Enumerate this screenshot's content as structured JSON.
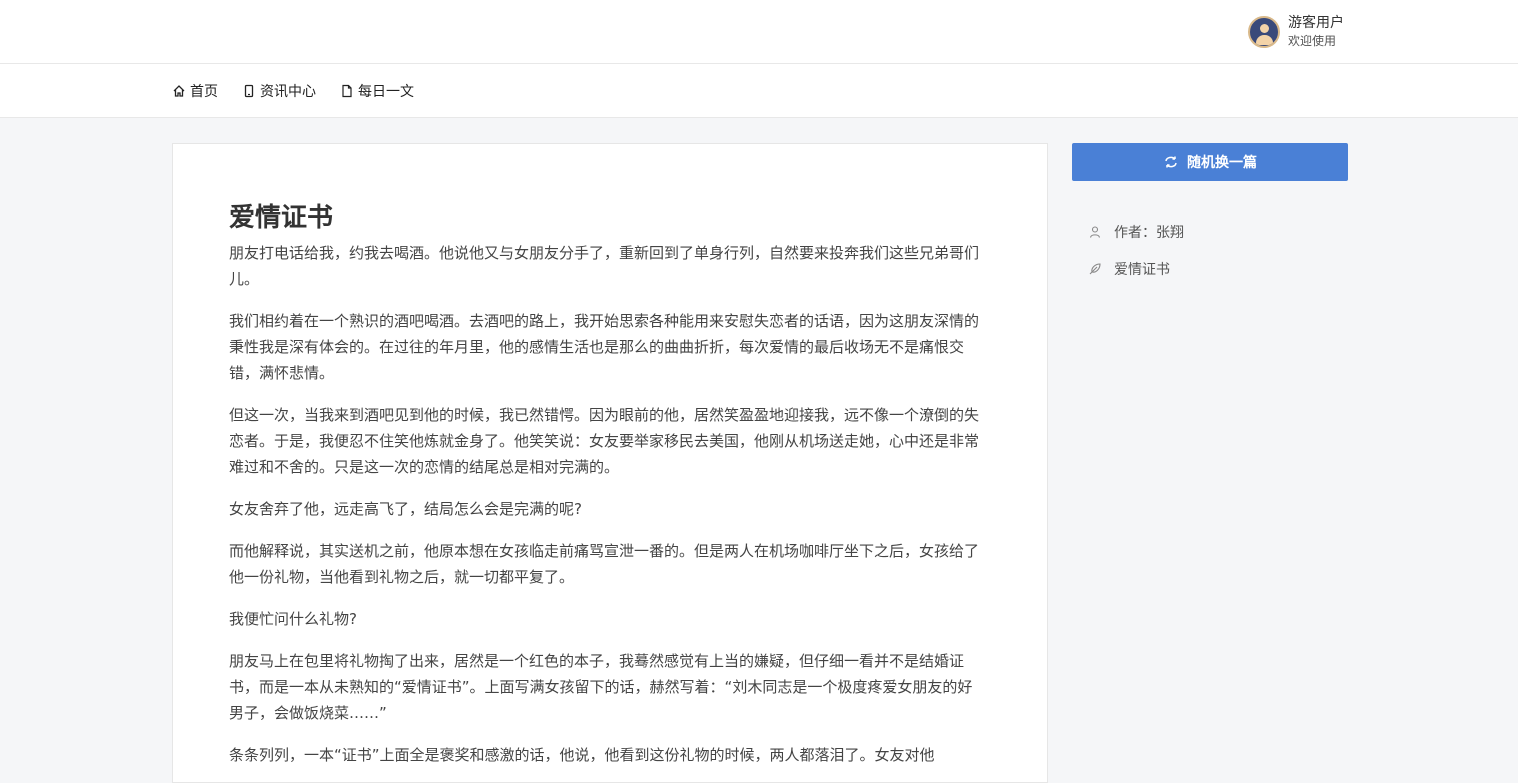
{
  "header": {
    "user_name": "游客用户",
    "user_sub": "欢迎使用"
  },
  "nav": {
    "items": [
      {
        "label": "首页",
        "icon": "home-icon"
      },
      {
        "label": "资讯中心",
        "icon": "mobile-icon"
      },
      {
        "label": "每日一文",
        "icon": "file-icon"
      }
    ]
  },
  "article": {
    "title": "爱情证书",
    "paragraphs": [
      "朋友打电话给我，约我去喝酒。他说他又与女朋友分手了，重新回到了单身行列，自然要来投奔我们这些兄弟哥们儿。",
      "我们相约着在一个熟识的酒吧喝酒。去酒吧的路上，我开始思索各种能用来安慰失恋者的话语，因为这朋友深情的秉性我是深有体会的。在过往的年月里，他的感情生活也是那么的曲曲折折，每次爱情的最后收场无不是痛恨交错，满怀悲情。",
      "但这一次，当我来到酒吧见到他的时候，我已然错愕。因为眼前的他，居然笑盈盈地迎接我，远不像一个潦倒的失恋者。于是，我便忍不住笑他炼就金身了。他笑笑说：女友要举家移民去美国，他刚从机场送走她，心中还是非常难过和不舍的。只是这一次的恋情的结尾总是相对完满的。",
      "女友舍弃了他，远走高飞了，结局怎么会是完满的呢?",
      "而他解释说，其实送机之前，他原本想在女孩临走前痛骂宣泄一番的。但是两人在机场咖啡厅坐下之后，女孩给了他一份礼物，当他看到礼物之后，就一切都平复了。",
      "我便忙问什么礼物?",
      "朋友马上在包里将礼物掏了出来，居然是一个红色的本子，我蓦然感觉有上当的嫌疑，但仔细一看并不是结婚证书，而是一本从未熟知的“爱情证书”。上面写满女孩留下的话，赫然写着：“刘木同志是一个极度疼爱女朋友的好男子，会做饭烧菜……”",
      "条条列列，一本“证书”上面全是褒奖和感激的话，他说，他看到这份礼物的时候，两人都落泪了。女友对他"
    ]
  },
  "sidebar": {
    "random_button": "随机换一篇",
    "author": "作者：张翔",
    "article_name": "爱情证书"
  },
  "colors": {
    "accent": "#4a80d6",
    "page_bg": "#f5f6f8"
  }
}
